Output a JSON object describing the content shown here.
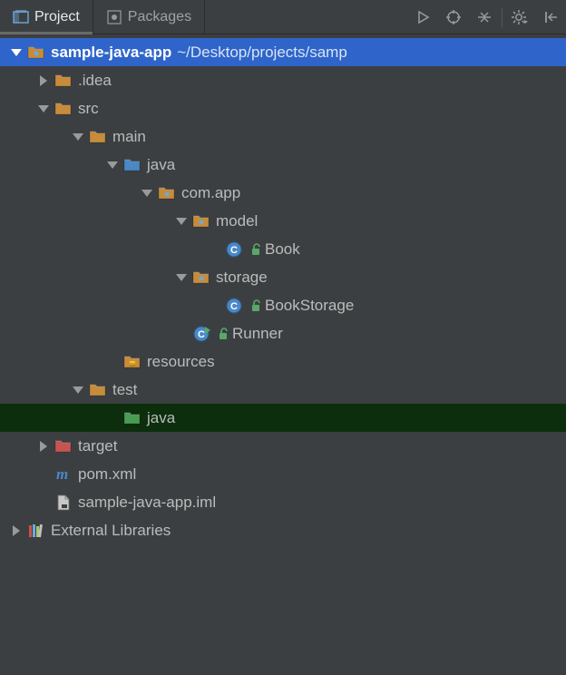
{
  "tabs": {
    "project": "Project",
    "packages": "Packages"
  },
  "tree": {
    "root": {
      "name": "sample-java-app",
      "path": "~/Desktop/projects/samp"
    },
    "idea": ".idea",
    "src": "src",
    "main": "main",
    "java_main": "java",
    "pkg": "com.app",
    "model": "model",
    "book": "Book",
    "storage": "storage",
    "bookstorage": "BookStorage",
    "runner": "Runner",
    "resources": "resources",
    "test": "test",
    "java_test": "java",
    "target": "target",
    "pom": "pom.xml",
    "iml": "sample-java-app.iml",
    "ext": "External Libraries"
  }
}
